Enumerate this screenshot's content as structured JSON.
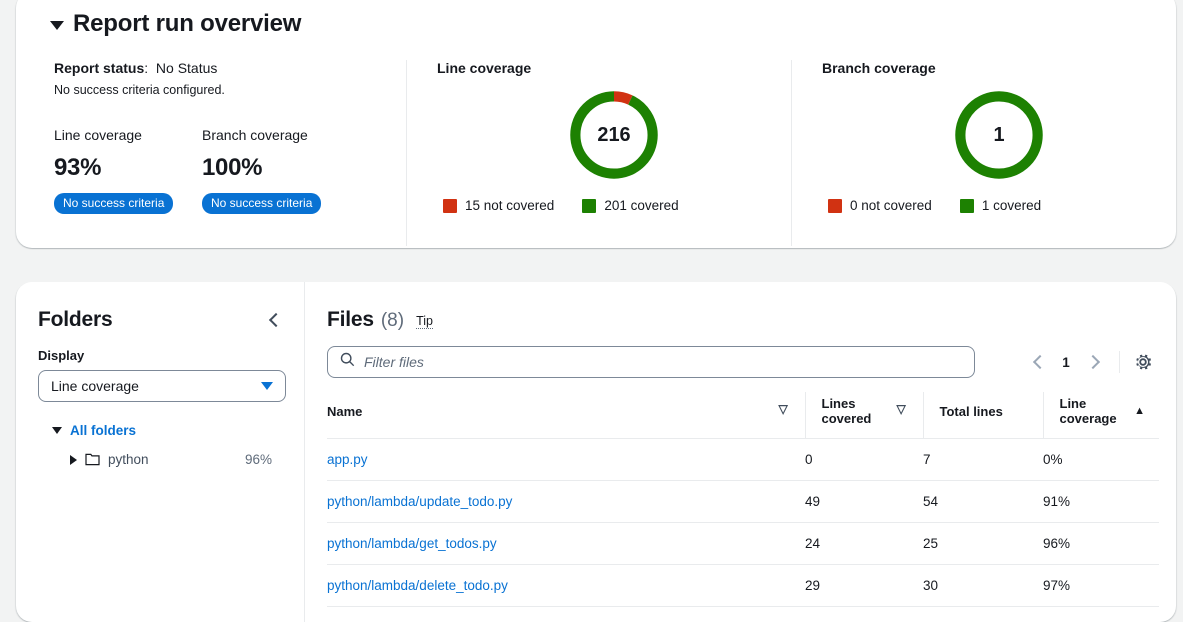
{
  "overview": {
    "title": "Report run overview",
    "collapse_icon": "triangle-down-icon",
    "status_label": "Report status",
    "status_separator": ":",
    "status_value": "No Status",
    "status_note": "No success criteria configured.",
    "metrics": [
      {
        "label": "Line coverage",
        "value": "93%",
        "badge": "No success criteria"
      },
      {
        "label": "Branch coverage",
        "value": "100%",
        "badge": "No success criteria"
      }
    ],
    "badge_color": "#0972d3"
  },
  "charts": [
    {
      "title": "Line coverage",
      "center": "216",
      "legend": [
        {
          "label": "15 not covered",
          "color": "#d13212"
        },
        {
          "label": "201 covered",
          "color": "#1d8102"
        }
      ]
    },
    {
      "title": "Branch coverage",
      "center": "1",
      "legend": [
        {
          "label": "0 not covered",
          "color": "#d13212"
        },
        {
          "label": "1 covered",
          "color": "#1d8102"
        }
      ]
    }
  ],
  "chart_data": [
    {
      "type": "pie",
      "title": "Line coverage",
      "center_label": "216",
      "categories": [
        "not covered",
        "covered"
      ],
      "values": [
        15,
        201
      ],
      "colors": [
        "#d13212",
        "#1d8102"
      ],
      "legend": [
        "15 not covered",
        "201 covered"
      ],
      "legend_position": "bottom",
      "total": 216
    },
    {
      "type": "pie",
      "title": "Branch coverage",
      "center_label": "1",
      "categories": [
        "not covered",
        "covered"
      ],
      "values": [
        0,
        1
      ],
      "colors": [
        "#d13212",
        "#1d8102"
      ],
      "legend": [
        "0 not covered",
        "1 covered"
      ],
      "legend_position": "bottom",
      "total": 1
    }
  ],
  "folders": {
    "title": "Folders",
    "collapse_icon": "chevron-left-icon",
    "display_label": "Display",
    "display_value": "Line coverage",
    "tree": {
      "root_label": "All folders",
      "items": [
        {
          "name": "python",
          "percent": "96%"
        }
      ]
    }
  },
  "files": {
    "title": "Files",
    "count": "(8)",
    "tip": "Tip",
    "search_placeholder": "Filter files",
    "search_value": "",
    "page_number": "1",
    "columns": [
      {
        "label": "Name",
        "sort": "inactive"
      },
      {
        "label": "Lines covered",
        "sort": "inactive"
      },
      {
        "label": "Total lines",
        "sort": "none"
      },
      {
        "label": "Line coverage",
        "sort": "asc"
      }
    ],
    "rows": [
      {
        "name": "app.py",
        "lines_covered": "0",
        "total_lines": "7",
        "line_coverage": "0%"
      },
      {
        "name": "python/lambda/update_todo.py",
        "lines_covered": "49",
        "total_lines": "54",
        "line_coverage": "91%"
      },
      {
        "name": "python/lambda/get_todos.py",
        "lines_covered": "24",
        "total_lines": "25",
        "line_coverage": "96%"
      },
      {
        "name": "python/lambda/delete_todo.py",
        "lines_covered": "29",
        "total_lines": "30",
        "line_coverage": "97%"
      }
    ]
  }
}
